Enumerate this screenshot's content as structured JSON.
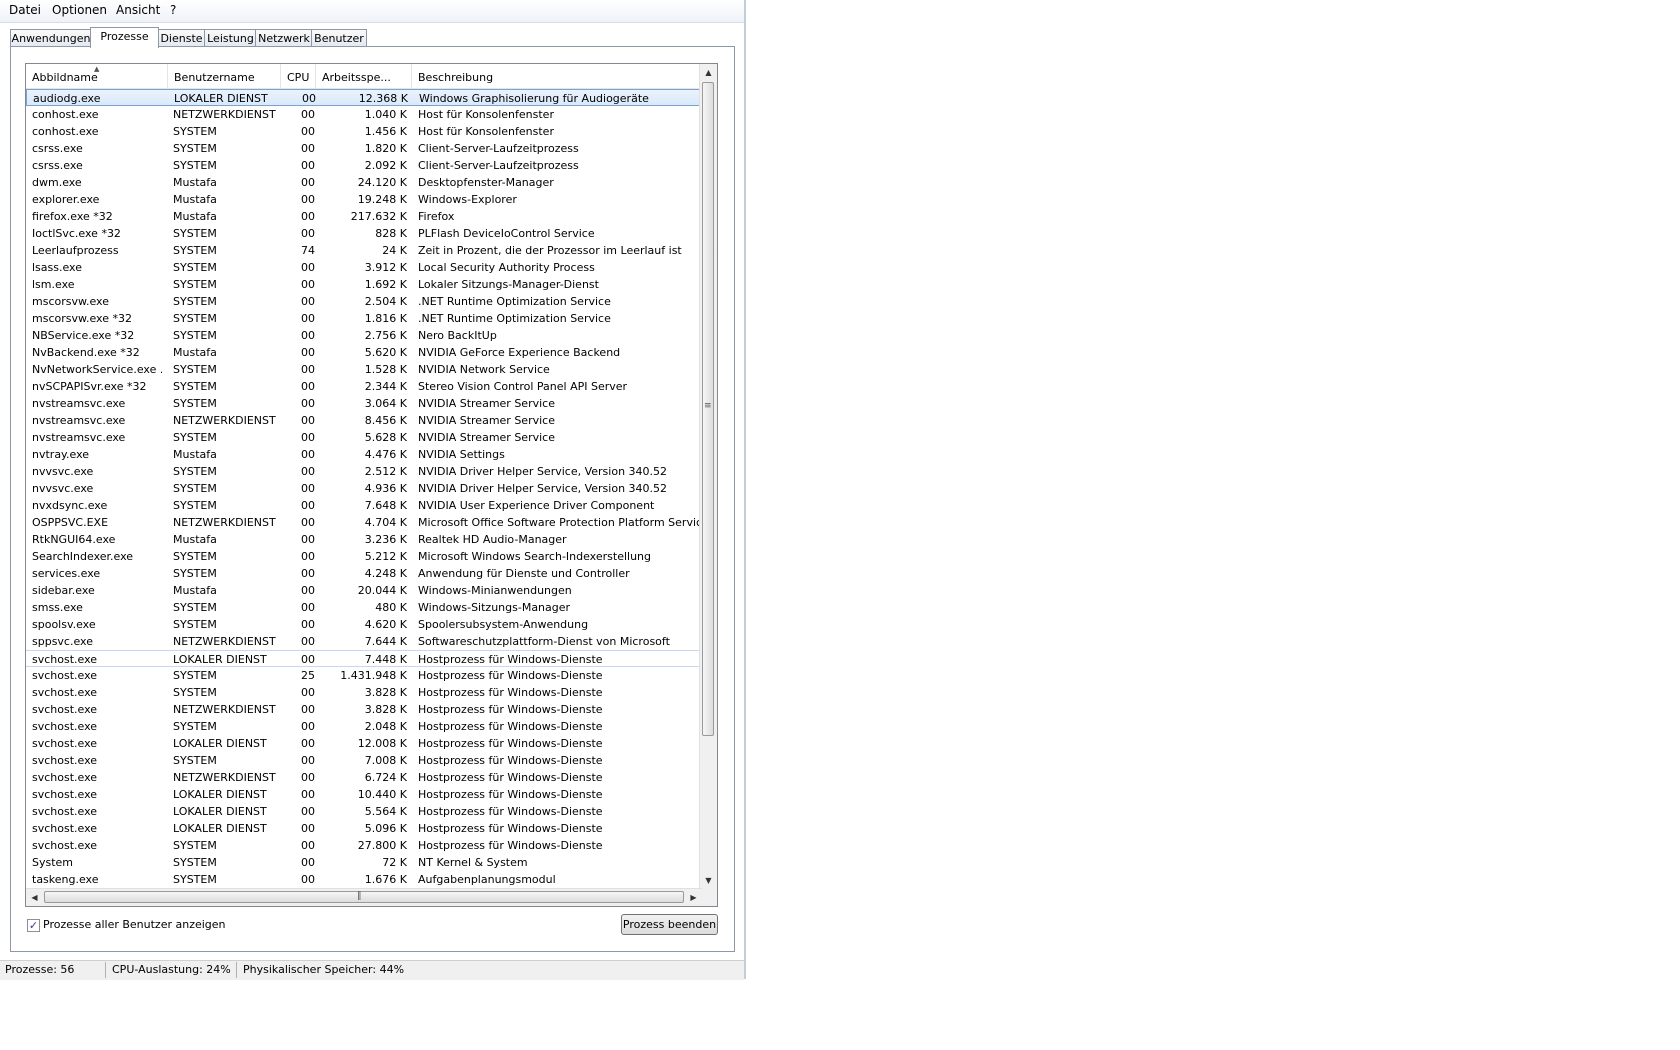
{
  "menu": [
    "Datei",
    "Optionen",
    "Ansicht",
    "?"
  ],
  "tabs": [
    "Anwendungen",
    "Prozesse",
    "Dienste",
    "Leistung",
    "Netzwerk",
    "Benutzer"
  ],
  "active_tab": "Prozesse",
  "columns": [
    "Abbildname",
    "Benutzername",
    "CPU",
    "Arbeitsspe...",
    "Beschreibung"
  ],
  "sort_column": "Abbildname",
  "selected_row": 0,
  "rows": [
    {
      "name": "audiodg.exe",
      "user": "LOKALER DIENST",
      "cpu": "00",
      "mem": "12.368 K",
      "desc": "Windows Graphisolierung für Audiogeräte"
    },
    {
      "name": "conhost.exe",
      "user": "NETZWERKDIENST",
      "cpu": "00",
      "mem": "1.040 K",
      "desc": "Host für Konsolenfenster"
    },
    {
      "name": "conhost.exe",
      "user": "SYSTEM",
      "cpu": "00",
      "mem": "1.456 K",
      "desc": "Host für Konsolenfenster"
    },
    {
      "name": "csrss.exe",
      "user": "SYSTEM",
      "cpu": "00",
      "mem": "1.820 K",
      "desc": "Client-Server-Laufzeitprozess"
    },
    {
      "name": "csrss.exe",
      "user": "SYSTEM",
      "cpu": "00",
      "mem": "2.092 K",
      "desc": "Client-Server-Laufzeitprozess"
    },
    {
      "name": "dwm.exe",
      "user": "Mustafa",
      "cpu": "00",
      "mem": "24.120 K",
      "desc": "Desktopfenster-Manager"
    },
    {
      "name": "explorer.exe",
      "user": "Mustafa",
      "cpu": "00",
      "mem": "19.248 K",
      "desc": "Windows-Explorer"
    },
    {
      "name": "firefox.exe *32",
      "user": "Mustafa",
      "cpu": "00",
      "mem": "217.632 K",
      "desc": "Firefox"
    },
    {
      "name": "IoctlSvc.exe *32",
      "user": "SYSTEM",
      "cpu": "00",
      "mem": "828 K",
      "desc": "PLFlash DeviceIoControl Service"
    },
    {
      "name": "Leerlaufprozess",
      "user": "SYSTEM",
      "cpu": "74",
      "mem": "24 K",
      "desc": "Zeit in Prozent, die der Prozessor im Leerlauf ist"
    },
    {
      "name": "lsass.exe",
      "user": "SYSTEM",
      "cpu": "00",
      "mem": "3.912 K",
      "desc": "Local Security Authority Process"
    },
    {
      "name": "lsm.exe",
      "user": "SYSTEM",
      "cpu": "00",
      "mem": "1.692 K",
      "desc": "Lokaler Sitzungs-Manager-Dienst"
    },
    {
      "name": "mscorsvw.exe",
      "user": "SYSTEM",
      "cpu": "00",
      "mem": "2.504 K",
      "desc": ".NET Runtime Optimization Service"
    },
    {
      "name": "mscorsvw.exe *32",
      "user": "SYSTEM",
      "cpu": "00",
      "mem": "1.816 K",
      "desc": ".NET Runtime Optimization Service"
    },
    {
      "name": "NBService.exe *32",
      "user": "SYSTEM",
      "cpu": "00",
      "mem": "2.756 K",
      "desc": "Nero BackItUp"
    },
    {
      "name": "NvBackend.exe *32",
      "user": "Mustafa",
      "cpu": "00",
      "mem": "5.620 K",
      "desc": "NVIDIA GeForce Experience Backend"
    },
    {
      "name": "NvNetworkService.exe ...",
      "user": "SYSTEM",
      "cpu": "00",
      "mem": "1.528 K",
      "desc": "NVIDIA Network Service"
    },
    {
      "name": "nvSCPAPISvr.exe *32",
      "user": "SYSTEM",
      "cpu": "00",
      "mem": "2.344 K",
      "desc": "Stereo Vision Control Panel API Server"
    },
    {
      "name": "nvstreamsvc.exe",
      "user": "SYSTEM",
      "cpu": "00",
      "mem": "3.064 K",
      "desc": "NVIDIA Streamer Service"
    },
    {
      "name": "nvstreamsvc.exe",
      "user": "NETZWERKDIENST",
      "cpu": "00",
      "mem": "8.456 K",
      "desc": "NVIDIA Streamer Service"
    },
    {
      "name": "nvstreamsvc.exe",
      "user": "SYSTEM",
      "cpu": "00",
      "mem": "5.628 K",
      "desc": "NVIDIA Streamer Service"
    },
    {
      "name": "nvtray.exe",
      "user": "Mustafa",
      "cpu": "00",
      "mem": "4.476 K",
      "desc": "NVIDIA Settings"
    },
    {
      "name": "nvvsvc.exe",
      "user": "SYSTEM",
      "cpu": "00",
      "mem": "2.512 K",
      "desc": "NVIDIA Driver Helper Service, Version 340.52"
    },
    {
      "name": "nvvsvc.exe",
      "user": "SYSTEM",
      "cpu": "00",
      "mem": "4.936 K",
      "desc": "NVIDIA Driver Helper Service, Version 340.52"
    },
    {
      "name": "nvxdsync.exe",
      "user": "SYSTEM",
      "cpu": "00",
      "mem": "7.648 K",
      "desc": "NVIDIA User Experience Driver Component"
    },
    {
      "name": "OSPPSVC.EXE",
      "user": "NETZWERKDIENST",
      "cpu": "00",
      "mem": "4.704 K",
      "desc": "Microsoft Office Software Protection Platform Service"
    },
    {
      "name": "RtkNGUI64.exe",
      "user": "Mustafa",
      "cpu": "00",
      "mem": "3.236 K",
      "desc": "Realtek HD Audio-Manager"
    },
    {
      "name": "SearchIndexer.exe",
      "user": "SYSTEM",
      "cpu": "00",
      "mem": "5.212 K",
      "desc": "Microsoft Windows Search-Indexerstellung"
    },
    {
      "name": "services.exe",
      "user": "SYSTEM",
      "cpu": "00",
      "mem": "4.248 K",
      "desc": "Anwendung für Dienste und Controller"
    },
    {
      "name": "sidebar.exe",
      "user": "Mustafa",
      "cpu": "00",
      "mem": "20.044 K",
      "desc": "Windows-Minianwendungen"
    },
    {
      "name": "smss.exe",
      "user": "SYSTEM",
      "cpu": "00",
      "mem": "480 K",
      "desc": "Windows-Sitzungs-Manager"
    },
    {
      "name": "spoolsv.exe",
      "user": "SYSTEM",
      "cpu": "00",
      "mem": "4.620 K",
      "desc": "Spoolersubsystem-Anwendung"
    },
    {
      "name": "sppsvc.exe",
      "user": "NETZWERKDIENST",
      "cpu": "00",
      "mem": "7.644 K",
      "desc": "Softwareschutzplattform-Dienst von Microsoft"
    },
    {
      "name": "svchost.exe",
      "user": "LOKALER DIENST",
      "cpu": "00",
      "mem": "7.448 K",
      "desc": "Hostprozess für Windows-Dienste"
    },
    {
      "name": "svchost.exe",
      "user": "SYSTEM",
      "cpu": "25",
      "mem": "1.431.948 K",
      "desc": "Hostprozess für Windows-Dienste"
    },
    {
      "name": "svchost.exe",
      "user": "SYSTEM",
      "cpu": "00",
      "mem": "3.828 K",
      "desc": "Hostprozess für Windows-Dienste"
    },
    {
      "name": "svchost.exe",
      "user": "NETZWERKDIENST",
      "cpu": "00",
      "mem": "3.828 K",
      "desc": "Hostprozess für Windows-Dienste"
    },
    {
      "name": "svchost.exe",
      "user": "SYSTEM",
      "cpu": "00",
      "mem": "2.048 K",
      "desc": "Hostprozess für Windows-Dienste"
    },
    {
      "name": "svchost.exe",
      "user": "LOKALER DIENST",
      "cpu": "00",
      "mem": "12.008 K",
      "desc": "Hostprozess für Windows-Dienste"
    },
    {
      "name": "svchost.exe",
      "user": "SYSTEM",
      "cpu": "00",
      "mem": "7.008 K",
      "desc": "Hostprozess für Windows-Dienste"
    },
    {
      "name": "svchost.exe",
      "user": "NETZWERKDIENST",
      "cpu": "00",
      "mem": "6.724 K",
      "desc": "Hostprozess für Windows-Dienste"
    },
    {
      "name": "svchost.exe",
      "user": "LOKALER DIENST",
      "cpu": "00",
      "mem": "10.440 K",
      "desc": "Hostprozess für Windows-Dienste"
    },
    {
      "name": "svchost.exe",
      "user": "LOKALER DIENST",
      "cpu": "00",
      "mem": "5.564 K",
      "desc": "Hostprozess für Windows-Dienste"
    },
    {
      "name": "svchost.exe",
      "user": "LOKALER DIENST",
      "cpu": "00",
      "mem": "5.096 K",
      "desc": "Hostprozess für Windows-Dienste"
    },
    {
      "name": "svchost.exe",
      "user": "SYSTEM",
      "cpu": "00",
      "mem": "27.800 K",
      "desc": "Hostprozess für Windows-Dienste"
    },
    {
      "name": "System",
      "user": "SYSTEM",
      "cpu": "00",
      "mem": "72 K",
      "desc": "NT Kernel & System"
    },
    {
      "name": "taskeng.exe",
      "user": "SYSTEM",
      "cpu": "00",
      "mem": "1.676 K",
      "desc": "Aufgabenplanungsmodul"
    }
  ],
  "checkbox": {
    "label": "Prozesse aller Benutzer anzeigen",
    "checked": true
  },
  "end_button": "Prozess beenden",
  "status": {
    "processes": "Prozesse: 56",
    "cpu": "CPU-Auslastung: 24%",
    "memory": "Physikalischer Speicher: 44%"
  }
}
